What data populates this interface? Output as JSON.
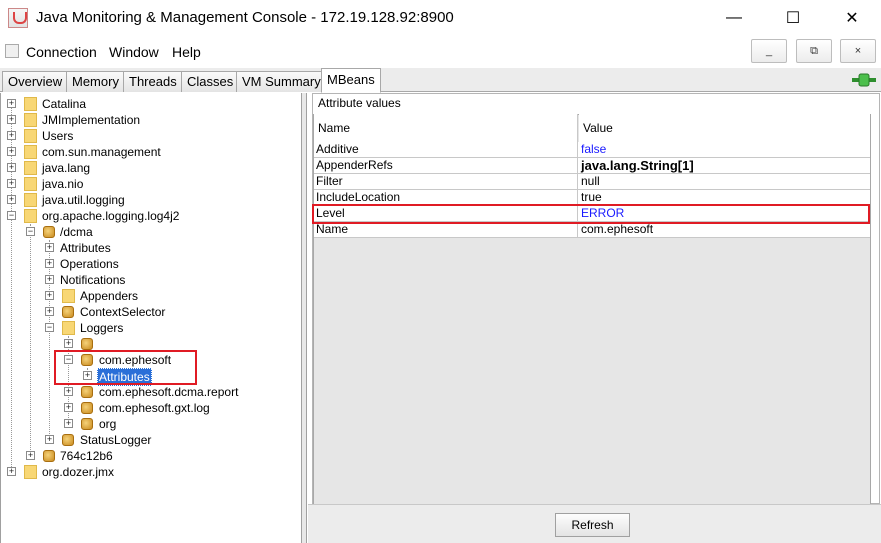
{
  "window": {
    "title": "Java Monitoring & Management Console - 172.19.128.92:8900",
    "minimize": "—",
    "maximize": "☐",
    "close": "✕"
  },
  "menu": {
    "items": [
      "Connection",
      "Window",
      "Help"
    ],
    "mdi_buttons": [
      "_",
      "⧉",
      "×"
    ]
  },
  "tabs": [
    "Overview",
    "Memory",
    "Threads",
    "Classes",
    "VM Summary",
    "MBeans"
  ],
  "active_tab": "MBeans",
  "tree": {
    "catalina": "Catalina",
    "jmimpl": "JMImplementation",
    "users": "Users",
    "sunmgmt": "com.sun.management",
    "javalang": "java.lang",
    "javanio": "java.nio",
    "javalogging": "java.util.logging",
    "log4j2": "org.apache.logging.log4j2",
    "dcma": "/dcma",
    "attributes": "Attributes",
    "operations": "Operations",
    "notifications": "Notifications",
    "appenders": "Appenders",
    "contextselector": "ContextSelector",
    "loggers": "Loggers",
    "ephesoft": "com.ephesoft",
    "ephesoft_attributes": "Attributes",
    "dcmareport": "com.ephesoft.dcma.report",
    "gxtlog": "com.ephesoft.gxt.log",
    "org": "org",
    "statuslogger": "StatusLogger",
    "hash": "764c12b6",
    "dozer": "org.dozer.jmx"
  },
  "attributes": {
    "group_title": "Attribute values",
    "col_name": "Name",
    "col_value": "Value",
    "rows": [
      {
        "name": "Additive",
        "value": "false"
      },
      {
        "name": "AppenderRefs",
        "value": "java.lang.String[1]"
      },
      {
        "name": "Filter",
        "value": "null"
      },
      {
        "name": "IncludeLocation",
        "value": "true"
      },
      {
        "name": "Level",
        "value": "ERROR"
      },
      {
        "name": "Name",
        "value": "com.ephesoft"
      }
    ],
    "refresh_label": "Refresh"
  },
  "colors": {
    "highlight_box": "#e01b24",
    "selection": "#2a6fd8",
    "value_blue": "#1a1aff"
  }
}
